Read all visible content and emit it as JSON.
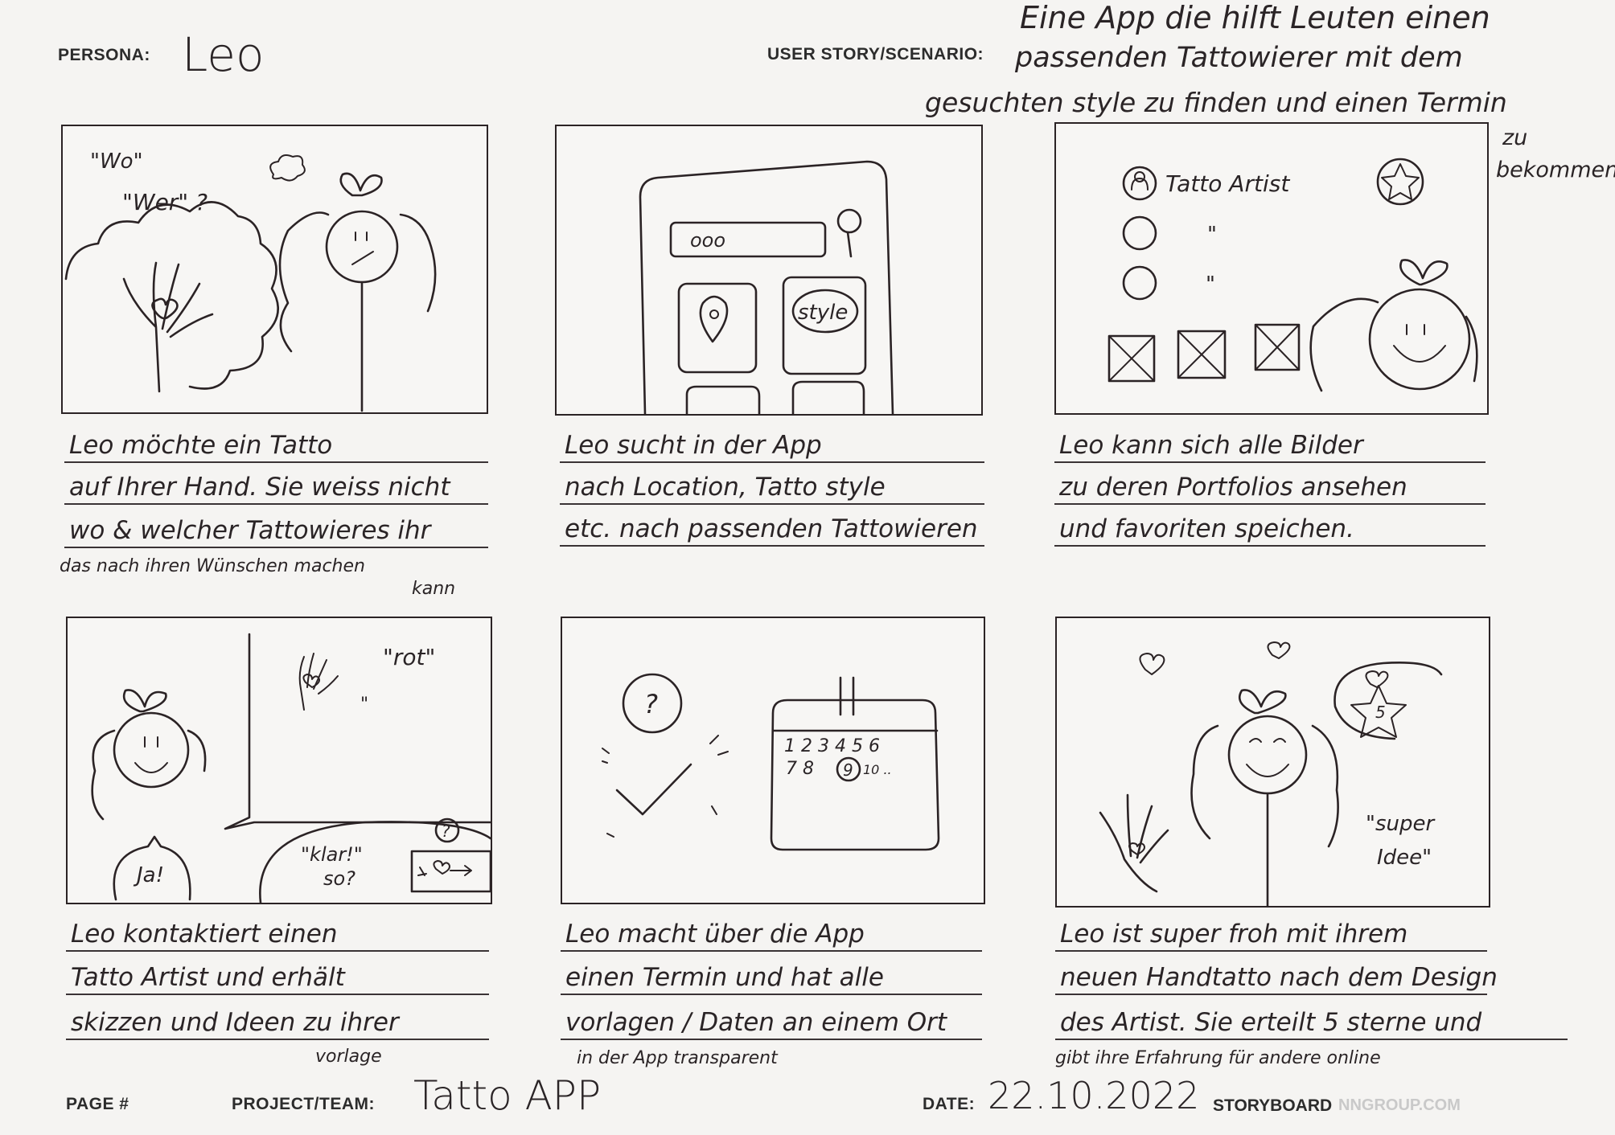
{
  "header": {
    "persona_label": "PERSONA:",
    "persona_value": "Leo",
    "story_label": "USER STORY/SCENARIO:",
    "story_lines": [
      "Eine App die hilft Leuten einen",
      "passenden Tattowierer mit dem",
      "gesuchten style zu finden und einen Termin",
      "zu",
      "bekommen"
    ]
  },
  "panels": [
    {
      "texts": [
        "\"Wo\"",
        "\"Wer\" ?"
      ],
      "caption": [
        "Leo möchte ein Tatto",
        "auf Ihrer Hand. Sie weiss nicht",
        "wo & welcher Tattowieres ihr"
      ],
      "caption_small": [
        "das nach ihren Wünschen machen",
        "kann"
      ]
    },
    {
      "texts": [
        "ooo",
        "style"
      ],
      "caption": [
        "Leo sucht in der App",
        "nach Location, Tatto style",
        "etc. nach passenden Tattowieren"
      ],
      "caption_small": []
    },
    {
      "texts": [
        "Tatto Artist",
        "\"",
        "\""
      ],
      "caption": [
        "Leo kann sich alle Bilder",
        "zu deren Portfolios ansehen",
        "und favoriten speichen."
      ],
      "caption_small": []
    },
    {
      "texts": [
        "\"rot\"",
        "\"",
        "Ja!",
        "\"klar!\"",
        "so?",
        "?"
      ],
      "caption": [
        "Leo kontaktiert einen",
        "Tatto Artist und erhält",
        "skizzen und Ideen zu ihrer"
      ],
      "caption_small": [
        "vorlage"
      ]
    },
    {
      "texts": [
        "?",
        "1 2 3 4 5 6",
        "7 8",
        "9",
        "10 .."
      ],
      "caption": [
        "Leo macht über die App",
        "einen Termin und hat alle",
        "vorlagen / Daten an einem Ort"
      ],
      "caption_small": [
        "in der App transparent"
      ]
    },
    {
      "texts": [
        "5",
        "\"super",
        "Idee\""
      ],
      "caption": [
        "Leo ist super froh mit ihrem",
        "neuen Handtatto nach dem Design",
        "des Artist. Sie erteilt 5 sterne und"
      ],
      "caption_small": [
        "gibt ihre Erfahrung für andere online"
      ]
    }
  ],
  "footer": {
    "page_label": "PAGE #",
    "project_label": "PROJECT/TEAM:",
    "project_value": "Tatto APP",
    "date_label": "DATE:",
    "date_value": "22.10.2022",
    "storyboard_label": "STORYBOARD",
    "brand": "NNGROUP.COM"
  }
}
